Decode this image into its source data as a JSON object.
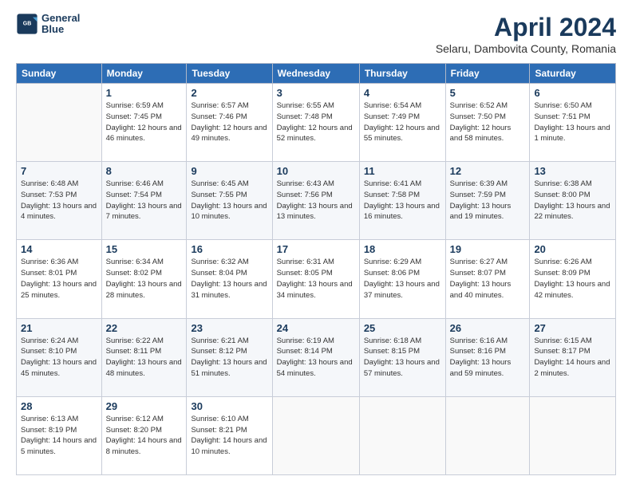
{
  "header": {
    "logo_line1": "General",
    "logo_line2": "Blue",
    "title": "April 2024",
    "subtitle": "Selaru, Dambovita County, Romania"
  },
  "calendar": {
    "days_of_week": [
      "Sunday",
      "Monday",
      "Tuesday",
      "Wednesday",
      "Thursday",
      "Friday",
      "Saturday"
    ],
    "weeks": [
      [
        {
          "day": "",
          "info": ""
        },
        {
          "day": "1",
          "info": "Sunrise: 6:59 AM\nSunset: 7:45 PM\nDaylight: 12 hours\nand 46 minutes."
        },
        {
          "day": "2",
          "info": "Sunrise: 6:57 AM\nSunset: 7:46 PM\nDaylight: 12 hours\nand 49 minutes."
        },
        {
          "day": "3",
          "info": "Sunrise: 6:55 AM\nSunset: 7:48 PM\nDaylight: 12 hours\nand 52 minutes."
        },
        {
          "day": "4",
          "info": "Sunrise: 6:54 AM\nSunset: 7:49 PM\nDaylight: 12 hours\nand 55 minutes."
        },
        {
          "day": "5",
          "info": "Sunrise: 6:52 AM\nSunset: 7:50 PM\nDaylight: 12 hours\nand 58 minutes."
        },
        {
          "day": "6",
          "info": "Sunrise: 6:50 AM\nSunset: 7:51 PM\nDaylight: 13 hours\nand 1 minute."
        }
      ],
      [
        {
          "day": "7",
          "info": "Sunrise: 6:48 AM\nSunset: 7:53 PM\nDaylight: 13 hours\nand 4 minutes."
        },
        {
          "day": "8",
          "info": "Sunrise: 6:46 AM\nSunset: 7:54 PM\nDaylight: 13 hours\nand 7 minutes."
        },
        {
          "day": "9",
          "info": "Sunrise: 6:45 AM\nSunset: 7:55 PM\nDaylight: 13 hours\nand 10 minutes."
        },
        {
          "day": "10",
          "info": "Sunrise: 6:43 AM\nSunset: 7:56 PM\nDaylight: 13 hours\nand 13 minutes."
        },
        {
          "day": "11",
          "info": "Sunrise: 6:41 AM\nSunset: 7:58 PM\nDaylight: 13 hours\nand 16 minutes."
        },
        {
          "day": "12",
          "info": "Sunrise: 6:39 AM\nSunset: 7:59 PM\nDaylight: 13 hours\nand 19 minutes."
        },
        {
          "day": "13",
          "info": "Sunrise: 6:38 AM\nSunset: 8:00 PM\nDaylight: 13 hours\nand 22 minutes."
        }
      ],
      [
        {
          "day": "14",
          "info": "Sunrise: 6:36 AM\nSunset: 8:01 PM\nDaylight: 13 hours\nand 25 minutes."
        },
        {
          "day": "15",
          "info": "Sunrise: 6:34 AM\nSunset: 8:02 PM\nDaylight: 13 hours\nand 28 minutes."
        },
        {
          "day": "16",
          "info": "Sunrise: 6:32 AM\nSunset: 8:04 PM\nDaylight: 13 hours\nand 31 minutes."
        },
        {
          "day": "17",
          "info": "Sunrise: 6:31 AM\nSunset: 8:05 PM\nDaylight: 13 hours\nand 34 minutes."
        },
        {
          "day": "18",
          "info": "Sunrise: 6:29 AM\nSunset: 8:06 PM\nDaylight: 13 hours\nand 37 minutes."
        },
        {
          "day": "19",
          "info": "Sunrise: 6:27 AM\nSunset: 8:07 PM\nDaylight: 13 hours\nand 40 minutes."
        },
        {
          "day": "20",
          "info": "Sunrise: 6:26 AM\nSunset: 8:09 PM\nDaylight: 13 hours\nand 42 minutes."
        }
      ],
      [
        {
          "day": "21",
          "info": "Sunrise: 6:24 AM\nSunset: 8:10 PM\nDaylight: 13 hours\nand 45 minutes."
        },
        {
          "day": "22",
          "info": "Sunrise: 6:22 AM\nSunset: 8:11 PM\nDaylight: 13 hours\nand 48 minutes."
        },
        {
          "day": "23",
          "info": "Sunrise: 6:21 AM\nSunset: 8:12 PM\nDaylight: 13 hours\nand 51 minutes."
        },
        {
          "day": "24",
          "info": "Sunrise: 6:19 AM\nSunset: 8:14 PM\nDaylight: 13 hours\nand 54 minutes."
        },
        {
          "day": "25",
          "info": "Sunrise: 6:18 AM\nSunset: 8:15 PM\nDaylight: 13 hours\nand 57 minutes."
        },
        {
          "day": "26",
          "info": "Sunrise: 6:16 AM\nSunset: 8:16 PM\nDaylight: 13 hours\nand 59 minutes."
        },
        {
          "day": "27",
          "info": "Sunrise: 6:15 AM\nSunset: 8:17 PM\nDaylight: 14 hours\nand 2 minutes."
        }
      ],
      [
        {
          "day": "28",
          "info": "Sunrise: 6:13 AM\nSunset: 8:19 PM\nDaylight: 14 hours\nand 5 minutes."
        },
        {
          "day": "29",
          "info": "Sunrise: 6:12 AM\nSunset: 8:20 PM\nDaylight: 14 hours\nand 8 minutes."
        },
        {
          "day": "30",
          "info": "Sunrise: 6:10 AM\nSunset: 8:21 PM\nDaylight: 14 hours\nand 10 minutes."
        },
        {
          "day": "",
          "info": ""
        },
        {
          "day": "",
          "info": ""
        },
        {
          "day": "",
          "info": ""
        },
        {
          "day": "",
          "info": ""
        }
      ]
    ]
  }
}
